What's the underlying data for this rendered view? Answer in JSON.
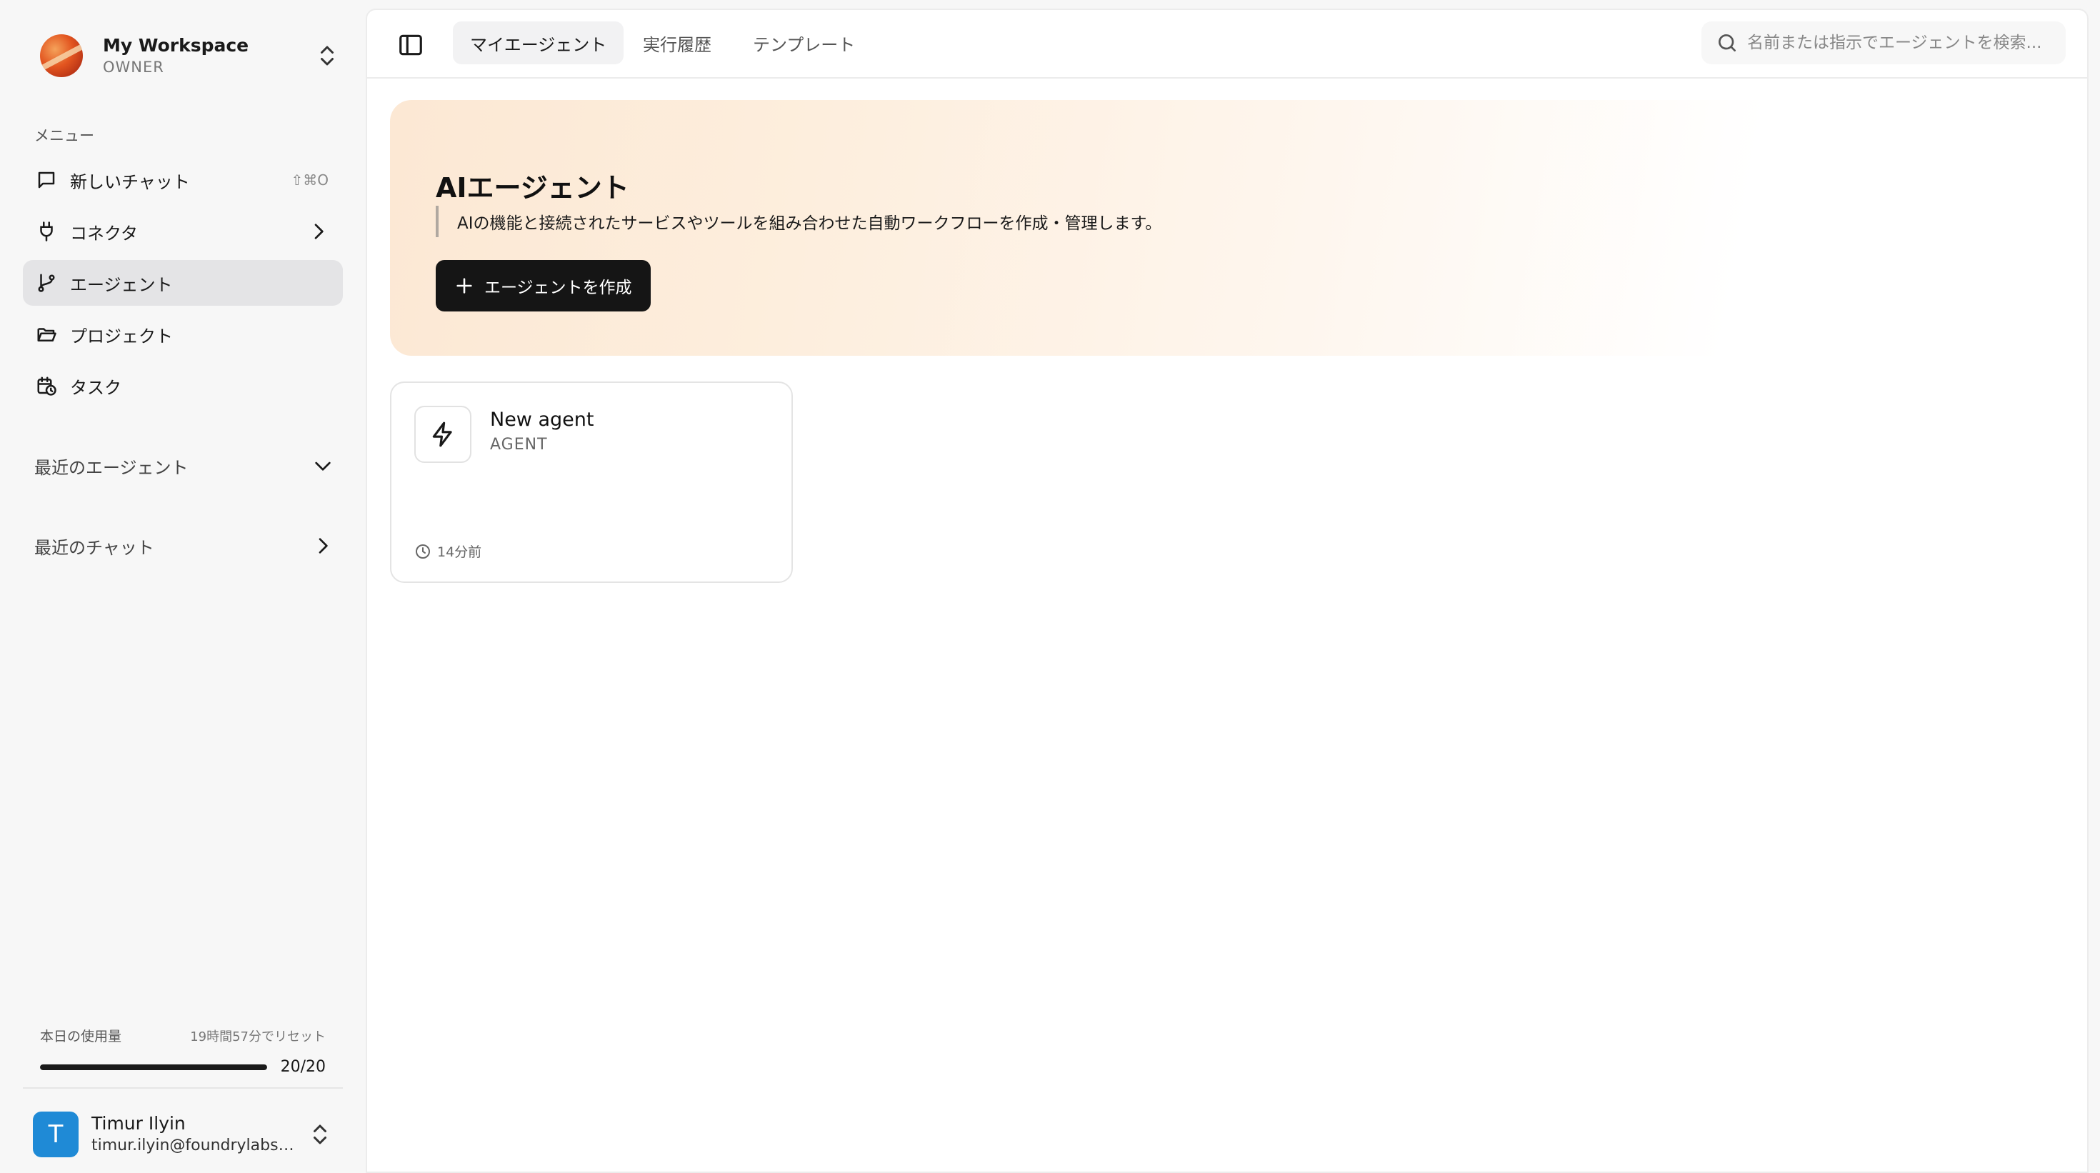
{
  "workspace": {
    "name": "My Workspace",
    "role": "OWNER"
  },
  "sidebar": {
    "menu_label": "メニュー",
    "items": [
      {
        "label": "新しいチャット",
        "icon": "chat-bubble-icon",
        "shortcut": "⇧⌘O"
      },
      {
        "label": "コネクタ",
        "icon": "plug-icon"
      },
      {
        "label": "エージェント",
        "icon": "branch-icon",
        "active": true
      },
      {
        "label": "プロジェクト",
        "icon": "folder-open-icon"
      },
      {
        "label": "タスク",
        "icon": "calendar-clock-icon"
      }
    ],
    "recent_agents_label": "最近のエージェント",
    "recent_chats_label": "最近のチャット"
  },
  "usage": {
    "label": "本日の使用量",
    "reset": "19時間57分でリセット",
    "count": "20/20",
    "fraction": 1.0
  },
  "user": {
    "initial": "T",
    "name": "Timur Ilyin",
    "email": "timur.ilyin@foundrylabs.c..."
  },
  "tabs": [
    {
      "label": "マイエージェント",
      "active": true
    },
    {
      "label": "実行履歴"
    },
    {
      "label": "テンプレート"
    }
  ],
  "search": {
    "placeholder": "名前または指示でエージェントを検索..."
  },
  "hero": {
    "title": "AIエージェント",
    "description": "AIの機能と接続されたサービスやツールを組み合わせた自動ワークフローを作成・管理します。",
    "create_label": "エージェントを作成"
  },
  "agents": [
    {
      "name": "New agent",
      "type": "AGENT",
      "time": "14分前",
      "icon": "lightning-icon"
    }
  ],
  "colors": {
    "accent": "#151515",
    "avatar": "#1f8ad6",
    "active_nav": "#e4e4e6"
  }
}
